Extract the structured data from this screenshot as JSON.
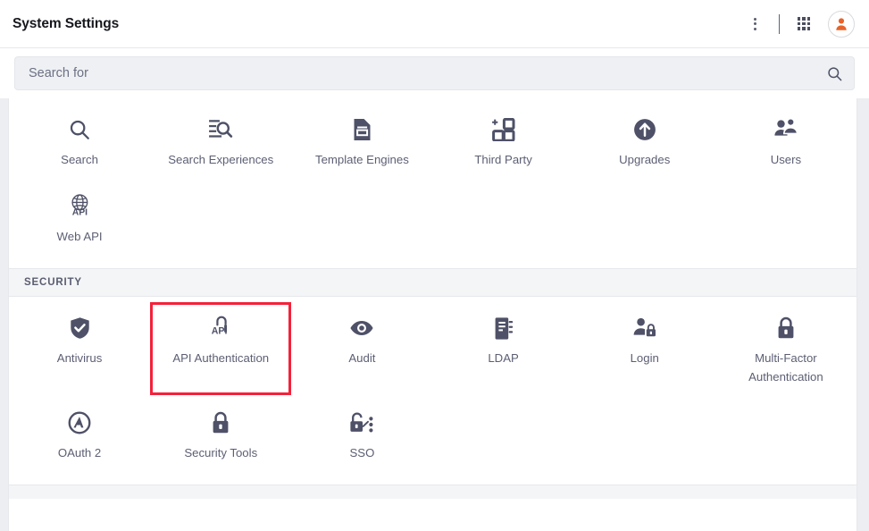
{
  "header": {
    "title": "System Settings",
    "menu_icon": "kebab-menu-icon",
    "apps_icon": "apps-grid-icon",
    "avatar_icon": "user-avatar-icon"
  },
  "search": {
    "placeholder": "Search for",
    "value": "",
    "icon": "search-icon"
  },
  "groups": [
    {
      "id": "general",
      "heading": null,
      "tiles": [
        {
          "label": "Search",
          "icon": "magnifier-icon",
          "highlighted": false
        },
        {
          "label": "Search Experiences",
          "icon": "document-search-icon",
          "highlighted": false
        },
        {
          "label": "Template Engines",
          "icon": "document-icon",
          "highlighted": false
        },
        {
          "label": "Third Party",
          "icon": "puzzle-add-squares-icon",
          "highlighted": false
        },
        {
          "label": "Upgrades",
          "icon": "circle-arrow-up-icon",
          "highlighted": false
        },
        {
          "label": "Users",
          "icon": "users-group-icon",
          "highlighted": false
        },
        {
          "label": "Web API",
          "icon": "globe-api-icon",
          "highlighted": false
        }
      ]
    },
    {
      "id": "security",
      "heading": "SECURITY",
      "tiles": [
        {
          "label": "Antivirus",
          "icon": "shield-check-icon",
          "highlighted": false
        },
        {
          "label": "API Authentication",
          "icon": "unlocked-padlock-api-icon",
          "highlighted": true
        },
        {
          "label": "Audit",
          "icon": "eye-icon",
          "highlighted": false
        },
        {
          "label": "LDAP",
          "icon": "address-book-icon",
          "highlighted": false
        },
        {
          "label": "Login",
          "icon": "person-lock-icon",
          "highlighted": false
        },
        {
          "label": "Multi-Factor Authentication",
          "icon": "padlock-icon",
          "highlighted": false
        },
        {
          "label": "OAuth 2",
          "icon": "circle-a-icon",
          "highlighted": false
        },
        {
          "label": "Security Tools",
          "icon": "padlock-icon",
          "highlighted": false
        },
        {
          "label": "SSO",
          "icon": "unlocked-padlock-dots-icon",
          "highlighted": false
        }
      ]
    }
  ],
  "colors": {
    "highlight": "#f4213a",
    "accent": "#e8632a",
    "icon": "#4e5167",
    "label": "#5c5f73",
    "page_bg": "#eceef1"
  }
}
